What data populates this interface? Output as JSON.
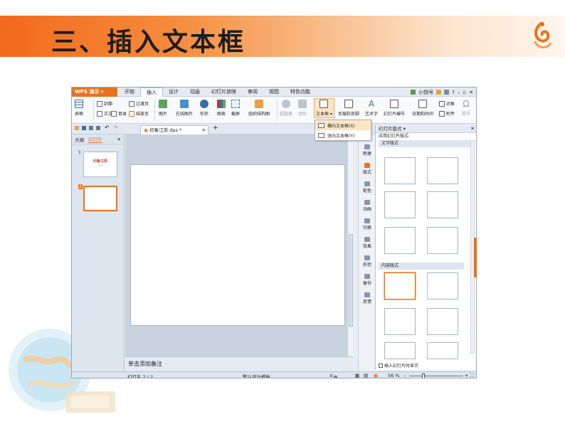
{
  "slide": {
    "title": "三、插入文本框"
  },
  "window": {
    "app_button": "WPS 演示",
    "menu_tabs": [
      "开始",
      "插入",
      "设计",
      "动画",
      "幻灯片放映",
      "审阅",
      "视图",
      "特色功能"
    ],
    "active_menu_tab": "插入",
    "account": "小悦号",
    "ribbon": {
      "table": "表格",
      "text": "正文",
      "cover": "封面",
      "catalog": "目录",
      "transition_page": "过渡页",
      "end_page": "结束页",
      "picture": "图片",
      "online_picture": "在线图片",
      "shape": "形状",
      "chart": "图表",
      "screenshot": "截屏",
      "org_chart": "组织结构图",
      "hyperlink": "超链接",
      "action": "动作",
      "textbox": "文本框",
      "header_footer": "页眉和页脚",
      "wordart": "艺术字",
      "slide_number": "幻灯片编号",
      "date_time": "日期和时间",
      "object": "对象",
      "attachment": "附件",
      "symbol": "符号"
    },
    "textbox_menu": [
      "横向文本框(X)",
      "竖向文本框(Y)"
    ],
    "doc_tab": "印象江苏.dps *",
    "thumb_tabs": [
      "大纲",
      "幻灯片"
    ],
    "active_thumb_tab": "幻灯片",
    "thumbnails": [
      {
        "number": "1",
        "title": "印象江苏",
        "subtitle": "——"
      },
      {
        "number": "2"
      }
    ],
    "notes_placeholder": "单击添加备注",
    "task_rail": [
      "新建",
      "版式",
      "配色",
      "动画",
      "切换",
      "效果",
      "形状",
      "备份",
      "反馈"
    ],
    "layout_pane": {
      "title": "幻灯片版式",
      "apply_label": "应用幻灯片版式:",
      "section_text": "文字版式",
      "section_content": "内容版式",
      "show_on_insert": "插入幻灯片时显示"
    },
    "status": {
      "slide_pos": "幻灯片 2 / 2",
      "template": "默认设计模板",
      "notes": "备注",
      "zoom": "56 %"
    }
  },
  "colors": {
    "accent": "#e8731f",
    "band_start": "#f26a1b"
  }
}
